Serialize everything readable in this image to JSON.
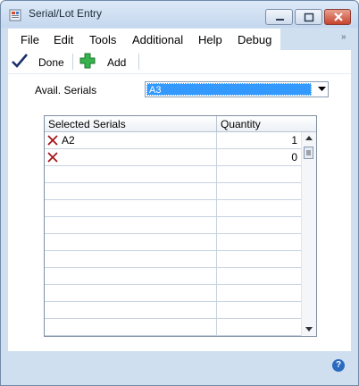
{
  "window": {
    "title": "Serial/Lot Entry"
  },
  "menu": [
    "File",
    "Edit",
    "Tools",
    "Additional",
    "Help",
    "Debug"
  ],
  "toolbar": {
    "done_label": "Done",
    "add_label": "Add"
  },
  "form": {
    "avail_serials_label": "Avail. Serials",
    "avail_serials_value": "A3"
  },
  "grid": {
    "columns": [
      "Selected Serials",
      "Quantity"
    ],
    "rows": [
      {
        "serial": "A2",
        "quantity": "1"
      },
      {
        "serial": "",
        "quantity": "0"
      }
    ]
  },
  "colors": {
    "selection": "#3399ff",
    "window_frame": "#cfdff0"
  }
}
